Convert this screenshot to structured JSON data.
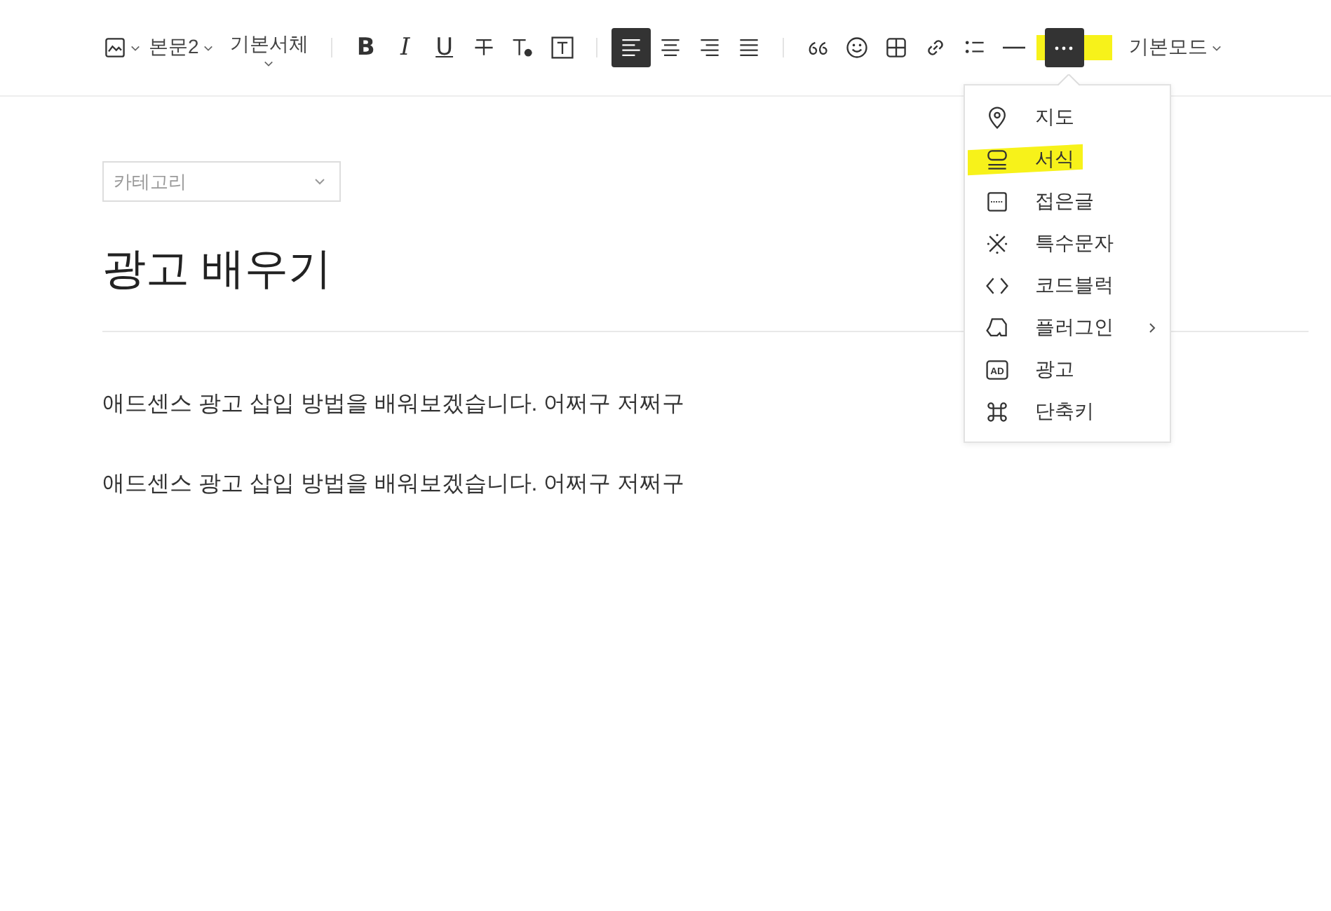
{
  "toolbar": [
    {
      "kind": "button",
      "selected": false,
      "highlighted": false
    },
    {
      "kind": "dropdown",
      "label": "본문2"
    },
    {
      "kind": "dropdown",
      "label": "기본서체"
    },
    {
      "kind": "separator"
    },
    {
      "kind": "letter",
      "label": "B",
      "selected": false
    },
    {
      "kind": "letter",
      "label": "I",
      "selected": false
    },
    {
      "kind": "letter",
      "label": "U",
      "selected": false
    },
    {
      "kind": "button",
      "selected": false,
      "highlighted": false
    },
    {
      "kind": "button",
      "selected": false,
      "highlighted": false
    },
    {
      "kind": "button",
      "selected": false,
      "highlighted": false
    },
    {
      "kind": "separator"
    },
    {
      "kind": "button",
      "selected": true,
      "highlighted": false
    },
    {
      "kind": "button",
      "selected": false,
      "highlighted": false
    },
    {
      "kind": "button",
      "selected": false,
      "highlighted": false
    },
    {
      "kind": "button",
      "selected": false,
      "highlighted": false
    },
    {
      "kind": "separator"
    },
    {
      "kind": "button",
      "selected": false,
      "highlighted": false
    },
    {
      "kind": "button",
      "selected": false,
      "highlighted": false
    },
    {
      "kind": "button",
      "selected": false,
      "highlighted": false
    },
    {
      "kind": "button",
      "selected": false,
      "highlighted": false
    },
    {
      "kind": "button",
      "selected": false,
      "highlighted": false
    },
    {
      "kind": "button",
      "selected": false,
      "highlighted": false
    },
    {
      "kind": "button",
      "selected": true,
      "highlighted": true
    },
    {
      "kind": "dropdown",
      "label": "기본모드"
    }
  ],
  "menu": [
    {
      "label": "지도",
      "submenu": false,
      "highlighted": false
    },
    {
      "label": "서식",
      "submenu": false,
      "highlighted": true
    },
    {
      "label": "접은글",
      "submenu": false,
      "highlighted": false
    },
    {
      "label": "특수문자",
      "submenu": false,
      "highlighted": false
    },
    {
      "label": "코드블럭",
      "submenu": false,
      "highlighted": false
    },
    {
      "label": "플러그인",
      "submenu": true,
      "highlighted": false
    },
    {
      "icon_text": "AD",
      "label": "광고",
      "submenu": false,
      "highlighted": false
    },
    {
      "label": "단축키",
      "submenu": false,
      "highlighted": false
    }
  ],
  "category": {
    "placeholder": "카테고리"
  },
  "title": "광고 배우기",
  "paragraphs": [
    "애드센스 광고 삽입 방법을 배워보겠습니다. 어쩌구 저쩌구",
    "애드센스 광고 삽입 방법을 배워보겠습니다. 어쩌구 저쩌구"
  ]
}
